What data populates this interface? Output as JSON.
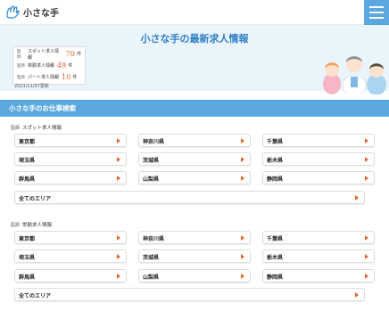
{
  "header": {
    "logo_text": "小さな手"
  },
  "hero": {
    "title": "小さな手の最新求人情報",
    "stats": [
      {
        "tag": "医師",
        "label": "スポット求人情報",
        "count": "70",
        "unit": "件"
      },
      {
        "tag": "医師",
        "label": "常勤求人情報",
        "count": "49",
        "unit": "件"
      },
      {
        "tag": "医師",
        "label": "パート求人情報",
        "count": "10",
        "unit": "件"
      }
    ],
    "updated": "2021/11/07更新"
  },
  "search": {
    "title": "小さな手のお仕事検索",
    "sections": [
      {
        "tag": "医師",
        "label": "スポット求人情報",
        "prefectures": [
          "東京都",
          "神奈川県",
          "千葉県",
          "埼玉県",
          "茨城県",
          "栃木県",
          "群馬県",
          "山梨県",
          "静岡県"
        ],
        "all_label": "全てのエリア"
      },
      {
        "tag": "医師",
        "label": "常勤求人情報",
        "prefectures": [
          "東京都",
          "神奈川県",
          "千葉県",
          "埼玉県",
          "茨城県",
          "栃木県",
          "群馬県",
          "山梨県",
          "静岡県"
        ],
        "all_label": "全てのエリア"
      }
    ]
  },
  "colors": {
    "accent": "#5aa8df",
    "title": "#2f7fc7",
    "count": "#e06030",
    "arrow": "#e26a2c"
  }
}
